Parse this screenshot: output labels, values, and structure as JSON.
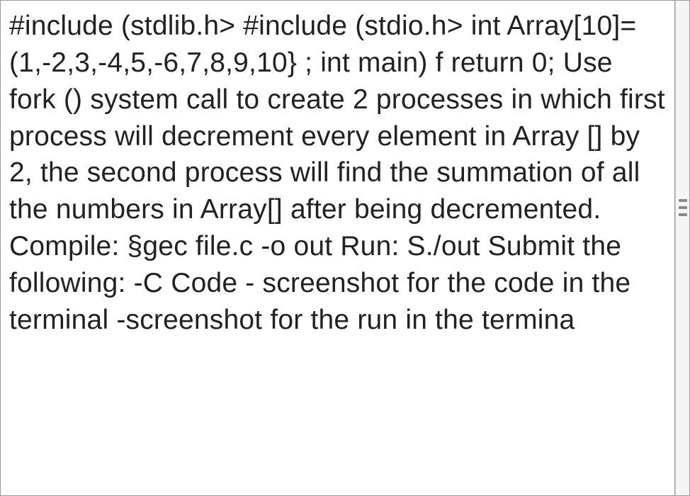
{
  "document": {
    "body_text": "#include (stdlib.h> #include (stdio.h> int Array[10]=(1,-2,3,-4,5,-6,7,8,9,10} ; int main) f return 0; Use fork () system call to create 2 processes in which first process will decrement every element in Array [] by 2, the second process will find the summation of all the numbers in Array[] after being decremented. Compile: §gec file.c -o out Run: S./out Submit the following: -C Code - screenshot for the code in the terminal -screenshot for the run in the termina"
  }
}
